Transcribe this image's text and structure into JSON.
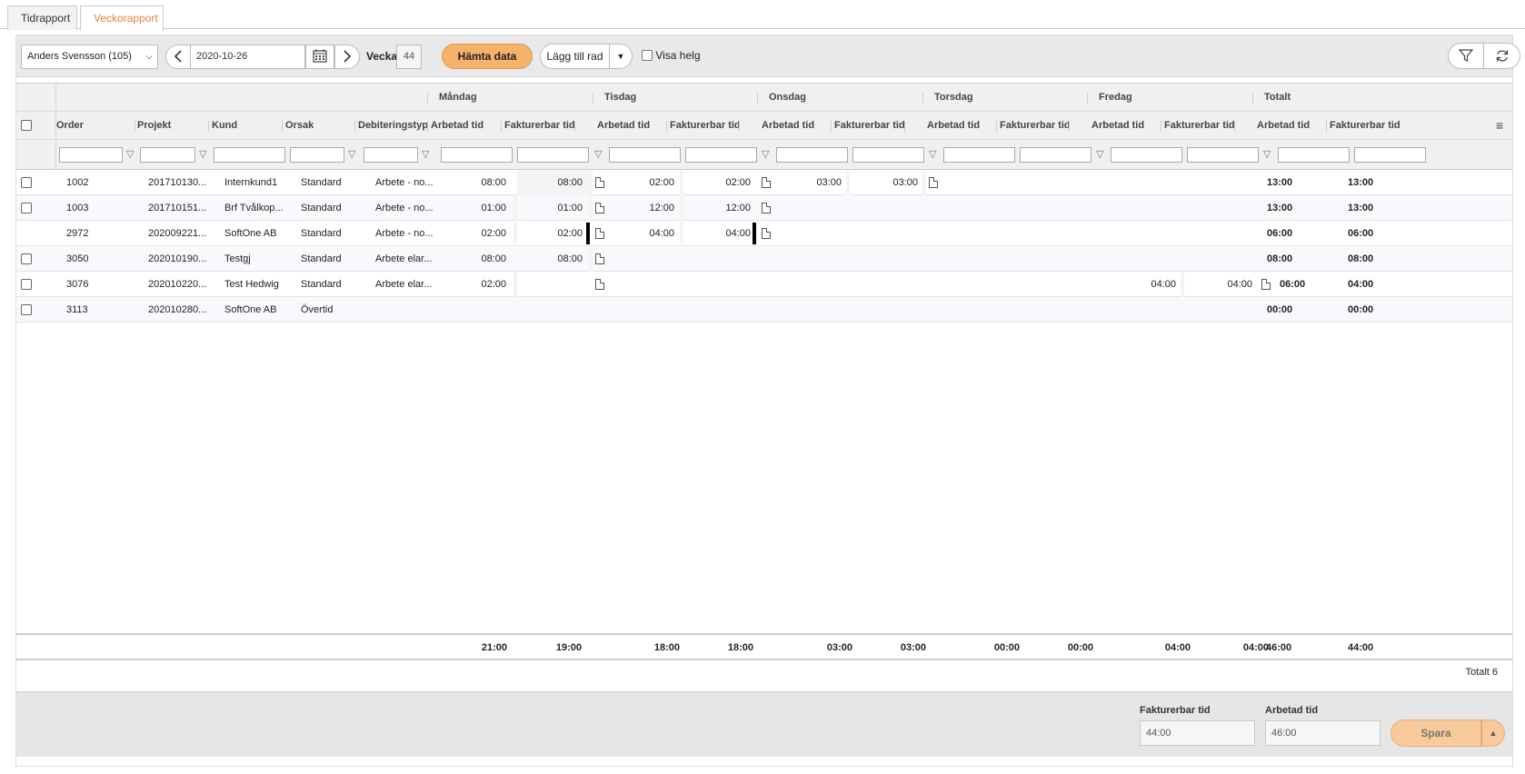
{
  "tabs": [
    "Tidrapport",
    "Veckorapport"
  ],
  "toolbar": {
    "employee": "Anders Svensson (105)",
    "date": "2020-10-26",
    "week_label": "Vecka",
    "week": "44",
    "fetch_label": "Hämta data",
    "add_row_label": "Lägg till rad",
    "show_weekend_label": "Visa helg"
  },
  "grid": {
    "day_headers": [
      "Måndag",
      "Tisdag",
      "Onsdag",
      "Torsdag",
      "Fredag",
      "Totalt"
    ],
    "col_headers": [
      "Order",
      "Projekt",
      "Kund",
      "Orsak",
      "Debiteringstyp",
      "Arbetad tid",
      "Fakturerbar tid",
      "Arbetad tid",
      "Fakturerbar tid",
      "Arbetad tid",
      "Fakturerbar tid",
      "Arbetad tid",
      "Fakturerbar tid",
      "Arbetad tid",
      "Fakturerbar tid",
      "Arbetad tid",
      "Fakturerbar tid"
    ],
    "rows": [
      {
        "order": "1002",
        "projekt": "201710130...",
        "kund": "Internkund1",
        "orsak": "Standard",
        "deb": "Arbete - no...",
        "mon_a": "08:00",
        "mon_f": "08:00",
        "tue_a": "02:00",
        "tue_f": "02:00",
        "wed_a": "03:00",
        "wed_f": "03:00",
        "thu_a": "",
        "thu_f": "",
        "fri_a": "",
        "fri_f": "",
        "tot_a": "13:00",
        "tot_f": "13:00"
      },
      {
        "order": "1003",
        "projekt": "201710151...",
        "kund": "Brf Tvålkop...",
        "orsak": "Standard",
        "deb": "Arbete - no...",
        "mon_a": "01:00",
        "mon_f": "01:00",
        "tue_a": "12:00",
        "tue_f": "12:00",
        "wed_a": "",
        "wed_f": "",
        "thu_a": "",
        "thu_f": "",
        "fri_a": "",
        "fri_f": "",
        "tot_a": "13:00",
        "tot_f": "13:00"
      },
      {
        "order": "2972",
        "projekt": "202009221...",
        "kund": "SoftOne AB",
        "orsak": "Standard",
        "deb": "Arbete - no...",
        "mon_a": "02:00",
        "mon_f": "02:00",
        "tue_a": "04:00",
        "tue_f": "04:00",
        "wed_a": "",
        "wed_f": "",
        "thu_a": "",
        "thu_f": "",
        "fri_a": "",
        "fri_f": "",
        "tot_a": "06:00",
        "tot_f": "06:00"
      },
      {
        "order": "3050",
        "projekt": "202010190...",
        "kund": "Testgj",
        "orsak": "Standard",
        "deb": "Arbete elar...",
        "mon_a": "08:00",
        "mon_f": "08:00",
        "tue_a": "",
        "tue_f": "",
        "wed_a": "",
        "wed_f": "",
        "thu_a": "",
        "thu_f": "",
        "fri_a": "",
        "fri_f": "",
        "tot_a": "08:00",
        "tot_f": "08:00"
      },
      {
        "order": "3076",
        "projekt": "202010220...",
        "kund": "Test Hedwig",
        "orsak": "Standard",
        "deb": "Arbete elar...",
        "mon_a": "02:00",
        "mon_f": "",
        "tue_a": "",
        "tue_f": "",
        "wed_a": "",
        "wed_f": "",
        "thu_a": "",
        "thu_f": "",
        "fri_a": "04:00",
        "fri_f": "04:00",
        "tot_a": "06:00",
        "tot_f": "04:00"
      },
      {
        "order": "3113",
        "projekt": "202010280...",
        "kund": "SoftOne AB",
        "orsak": "Övertid",
        "deb": "",
        "mon_a": "",
        "mon_f": "",
        "tue_a": "",
        "tue_f": "",
        "wed_a": "",
        "wed_f": "",
        "thu_a": "",
        "thu_f": "",
        "fri_a": "",
        "fri_f": "",
        "tot_a": "00:00",
        "tot_f": "00:00"
      }
    ],
    "totals": [
      "21:00",
      "19:00",
      "18:00",
      "18:00",
      "03:00",
      "03:00",
      "00:00",
      "00:00",
      "04:00",
      "04:00",
      "46:00",
      "44:00"
    ],
    "row_count_text": "Totalt 6"
  },
  "footer": {
    "billable_label": "Fakturerbar tid",
    "billable_value": "44:00",
    "worked_label": "Arbetad tid",
    "worked_value": "46:00",
    "save_label": "Spara"
  }
}
